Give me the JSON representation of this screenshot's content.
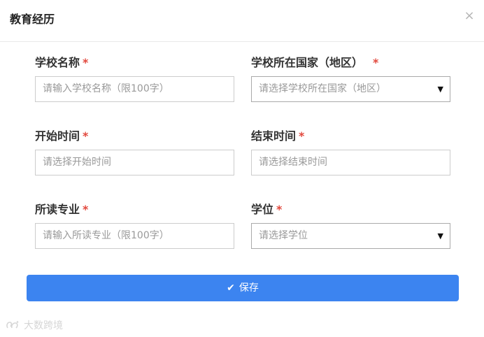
{
  "dialog": {
    "title": "教育经历",
    "close_icon": "close-icon"
  },
  "required_mark": "*",
  "fields": {
    "school_name": {
      "label": "学校名称",
      "placeholder": "请输入学校名称（限100字）"
    },
    "school_country": {
      "label": "学校所在国家（地区）",
      "placeholder": "请选择学校所在国家（地区）"
    },
    "start_time": {
      "label": "开始时间",
      "placeholder": "请选择开始时间"
    },
    "end_time": {
      "label": "结束时间",
      "placeholder": "请选择结束时间"
    },
    "major": {
      "label": "所读专业",
      "placeholder": "请输入所读专业（限100字）"
    },
    "degree": {
      "label": "学位",
      "placeholder": "请选择学位"
    }
  },
  "save_button": {
    "label": "保存",
    "icon": "check-icon"
  },
  "watermark": {
    "text": "大数跨境"
  },
  "colors": {
    "accent": "#3c84f0",
    "required": "#e2483d",
    "border": "#cccccc",
    "placeholder": "#999999"
  }
}
